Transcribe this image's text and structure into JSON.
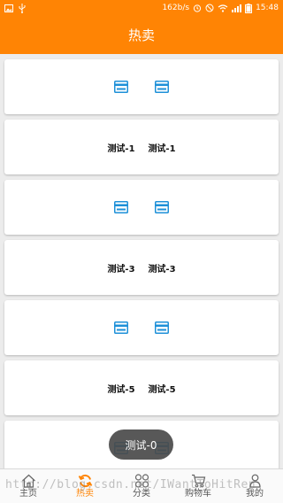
{
  "status_bar": {
    "net_speed": "162b/s",
    "time": "15:48"
  },
  "toolbar": {
    "title": "热卖"
  },
  "cards": [
    {
      "type": "icons"
    },
    {
      "type": "text",
      "left": "测试-1",
      "right": "测试-1"
    },
    {
      "type": "icons"
    },
    {
      "type": "text",
      "left": "测试-3",
      "right": "测试-3"
    },
    {
      "type": "icons"
    },
    {
      "type": "text",
      "left": "测试-5",
      "right": "测试-5"
    },
    {
      "type": "icons"
    }
  ],
  "toast": {
    "text": "测试-0"
  },
  "bottom_nav": {
    "items": [
      {
        "label": "主页",
        "icon": "home-icon"
      },
      {
        "label": "热卖",
        "icon": "refresh-icon"
      },
      {
        "label": "分类",
        "icon": "grid-icon"
      },
      {
        "label": "购物车",
        "icon": "cart-icon"
      },
      {
        "label": "我的",
        "icon": "user-icon"
      }
    ],
    "active_index": 1
  },
  "colors": {
    "accent": "#ff8404",
    "card_icon": "#1e90d8"
  },
  "watermark": "http://blog.csdn.net/IWantToHitRen"
}
